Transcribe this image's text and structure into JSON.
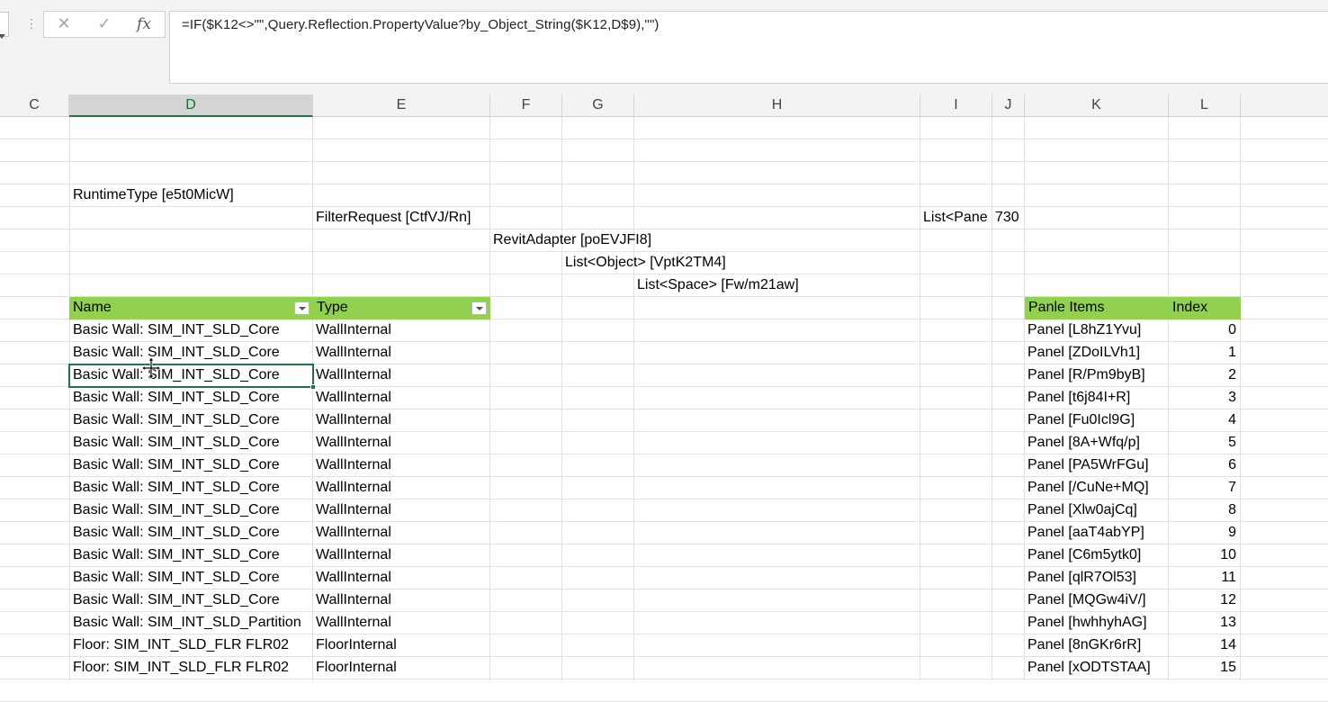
{
  "formula_bar": {
    "formula": "=IF($K12<>\"\",Query.Reflection.PropertyValue?by_Object_String($K12,D$9),\"\")",
    "cancel_glyph": "✕",
    "enter_glyph": "✓",
    "fx_label": "fx",
    "grip_glyph": "⋮"
  },
  "columns": [
    {
      "letter": "C"
    },
    {
      "letter": "D"
    },
    {
      "letter": "E"
    },
    {
      "letter": "F"
    },
    {
      "letter": "G"
    },
    {
      "letter": "H"
    },
    {
      "letter": "I"
    },
    {
      "letter": "J"
    },
    {
      "letter": "K"
    },
    {
      "letter": "L"
    }
  ],
  "active_column": "D",
  "cells": {
    "runtime_type": "RuntimeType [e5t0MicW]",
    "filter_request": "FilterRequest [CtfVJ/Rn]",
    "list_pane": "List<Pane",
    "list_pane_count": "730",
    "revit_adapter": "RevitAdapter [poEVJFI8]",
    "list_object": "List<Object> [VptK2TM4]",
    "list_space": "List<Space> [Fw/m21aw]"
  },
  "table1": {
    "headers": {
      "name": "Name",
      "type": "Type"
    },
    "rows": [
      {
        "name": "Basic Wall: SIM_INT_SLD_Core",
        "type": "WallInternal"
      },
      {
        "name": "Basic Wall: SIM_INT_SLD_Core",
        "type": "WallInternal"
      },
      {
        "name": "Basic Wall: SIM_INT_SLD_Core",
        "type": "WallInternal"
      },
      {
        "name": "Basic Wall: SIM_INT_SLD_Core",
        "type": "WallInternal"
      },
      {
        "name": "Basic Wall: SIM_INT_SLD_Core",
        "type": "WallInternal"
      },
      {
        "name": "Basic Wall: SIM_INT_SLD_Core",
        "type": "WallInternal"
      },
      {
        "name": "Basic Wall: SIM_INT_SLD_Core",
        "type": "WallInternal"
      },
      {
        "name": "Basic Wall: SIM_INT_SLD_Core",
        "type": "WallInternal"
      },
      {
        "name": "Basic Wall: SIM_INT_SLD_Core",
        "type": "WallInternal"
      },
      {
        "name": "Basic Wall: SIM_INT_SLD_Core",
        "type": "WallInternal"
      },
      {
        "name": "Basic Wall: SIM_INT_SLD_Core",
        "type": "WallInternal"
      },
      {
        "name": "Basic Wall: SIM_INT_SLD_Core",
        "type": "WallInternal"
      },
      {
        "name": "Basic Wall: SIM_INT_SLD_Core",
        "type": "WallInternal"
      },
      {
        "name": "Basic Wall: SIM_INT_SLD_Partition",
        "type": "WallInternal"
      },
      {
        "name": "Floor: SIM_INT_SLD_FLR FLR02",
        "type": "FloorInternal"
      },
      {
        "name": "Floor: SIM_INT_SLD_FLR FLR02",
        "type": "FloorInternal"
      }
    ]
  },
  "table2": {
    "headers": {
      "items": "Panle Items",
      "index": "Index"
    },
    "rows": [
      {
        "item": "Panel [L8hZ1Yvu]",
        "index": "0"
      },
      {
        "item": "Panel [ZDoILVh1]",
        "index": "1"
      },
      {
        "item": "Panel [R/Pm9byB]",
        "index": "2"
      },
      {
        "item": "Panel [t6j84I+R]",
        "index": "3"
      },
      {
        "item": "Panel [Fu0Icl9G]",
        "index": "4"
      },
      {
        "item": "Panel [8A+Wfq/p]",
        "index": "5"
      },
      {
        "item": "Panel [PA5WrFGu]",
        "index": "6"
      },
      {
        "item": "Panel [/CuNe+MQ]",
        "index": "7"
      },
      {
        "item": "Panel [Xlw0ajCq]",
        "index": "8"
      },
      {
        "item": "Panel [aaT4abYP]",
        "index": "9"
      },
      {
        "item": "Panel [C6m5ytk0]",
        "index": "10"
      },
      {
        "item": "Panel [qlR7Ol53]",
        "index": "11"
      },
      {
        "item": "Panel [MQGw4iV/]",
        "index": "12"
      },
      {
        "item": "Panel [hwhhyhAG]",
        "index": "13"
      },
      {
        "item": "Panel [8nGKr6rR]",
        "index": "14"
      },
      {
        "item": "Panel [xODTSTAA]",
        "index": "15"
      }
    ]
  },
  "colors": {
    "table_header_fill": "#92d050",
    "selection_border": "#217346",
    "gridline": "#e1e1e1"
  }
}
